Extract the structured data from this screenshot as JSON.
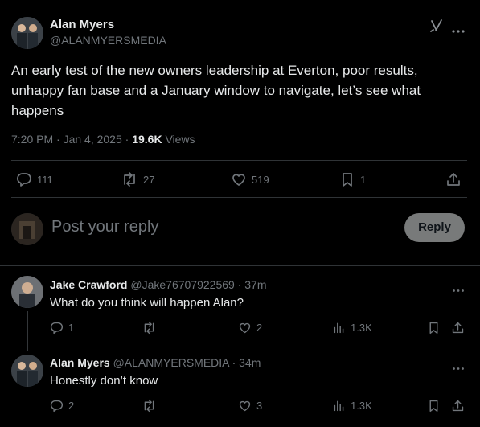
{
  "post": {
    "author_name": "Alan Myers",
    "author_handle": "@ALANMYERSMEDIA",
    "text": "An early test of the new owners leadership at Everton, poor results, unhappy fan base and a January window to navigate, let’s see what happens",
    "time": "7:20 PM · Jan 4, 2025 · ",
    "views_count": "19.6K",
    "views_label": " Views",
    "stats": {
      "replies": "111",
      "reposts": "27",
      "likes": "519",
      "bookmarks": "1"
    }
  },
  "reply_box": {
    "placeholder": "Post your reply",
    "button_label": "Reply"
  },
  "replies": [
    {
      "name": "Jake Crawford",
      "handle": "@Jake76707922569",
      "time": " · 37m",
      "text": "What do you think will happen Alan?",
      "stats": {
        "replies": "1",
        "likes": "2",
        "views": "1.3K"
      }
    },
    {
      "name": "Alan Myers",
      "handle": "@ALANMYERSMEDIA",
      "time": " · 34m",
      "text": "Honestly don’t know",
      "stats": {
        "replies": "2",
        "likes": "3",
        "views": "1.3K"
      }
    }
  ],
  "colors": {
    "background": "#000000",
    "text": "#e7e9ea",
    "muted": "#71767b",
    "divider": "#2f3336",
    "reply_button_bg": "#787a7a"
  },
  "icons": [
    "grok-icon",
    "more-icon",
    "reply-icon",
    "repost-icon",
    "like-icon",
    "bookmark-icon",
    "share-icon",
    "views-icon"
  ]
}
